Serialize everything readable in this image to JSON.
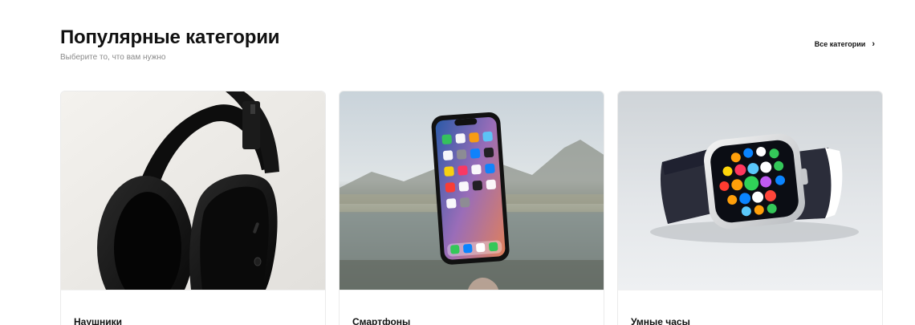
{
  "section": {
    "title": "Популярные категории",
    "subtitle": "Выберите то, что вам нужно",
    "all_link_label": "Все категории",
    "all_link_icon": "chevron-right-icon"
  },
  "categories": [
    {
      "label": "Наушники",
      "image": "headphones-photo"
    },
    {
      "label": "Смартфоны",
      "image": "smartphone-photo"
    },
    {
      "label": "Умные часы",
      "image": "smartwatch-photo"
    }
  ]
}
